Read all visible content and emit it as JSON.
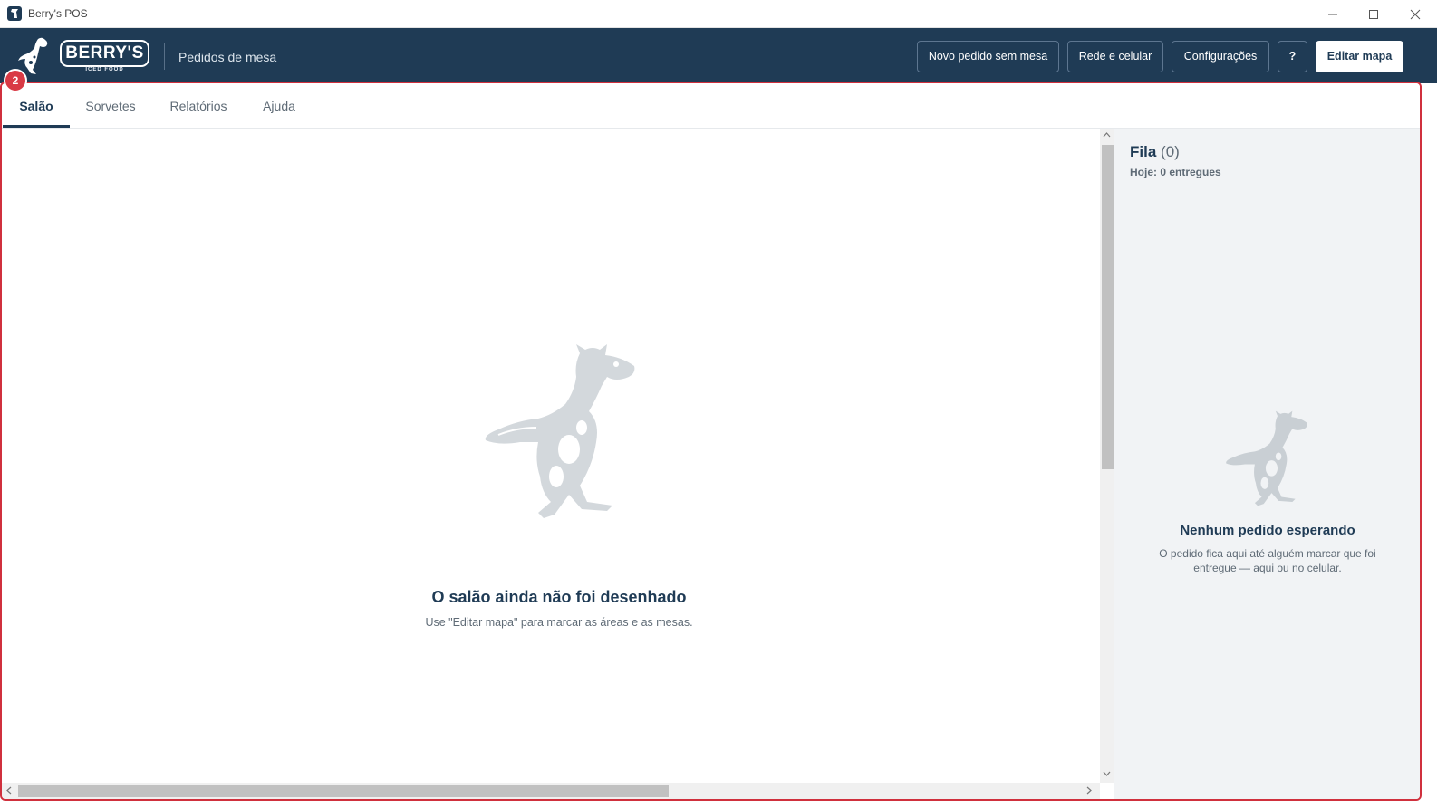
{
  "window": {
    "title": "Berry's POS",
    "icon": "app-icon",
    "controls": [
      "minimize-icon",
      "maximize-icon",
      "close-icon"
    ]
  },
  "header": {
    "logo_text": "BERRY'S",
    "logo_subtext": "ICED FOOD",
    "page_title": "Pedidos de mesa",
    "buttons": {
      "new_order": "Novo pedido sem mesa",
      "network": "Rede e celular",
      "settings": "Configurações",
      "help": "?",
      "edit_map": "Editar mapa"
    }
  },
  "annotation_badge": "2",
  "tabs": [
    {
      "label": "Salão",
      "active": true
    },
    {
      "label": "Sorvetes",
      "active": false
    },
    {
      "label": "Relatórios",
      "active": false
    },
    {
      "label": "Ajuda",
      "active": false
    }
  ],
  "floor": {
    "empty_title": "O salão ainda não foi desenhado",
    "empty_subtitle": "Use \"Editar mapa\" para marcar as áreas e as mesas."
  },
  "queue": {
    "title": "Fila",
    "count": "(0)",
    "today": "Hoje: 0 entregues",
    "empty_title": "Nenhum pedido esperando",
    "empty_subtitle": "O pedido fica aqui até alguém marcar que foi entregue — aqui ou no celular."
  },
  "colors": {
    "brand": "#1f3b55",
    "accent_red": "#d0303d",
    "muted_text": "#5f6b76",
    "queue_bg": "#f1f3f5"
  }
}
